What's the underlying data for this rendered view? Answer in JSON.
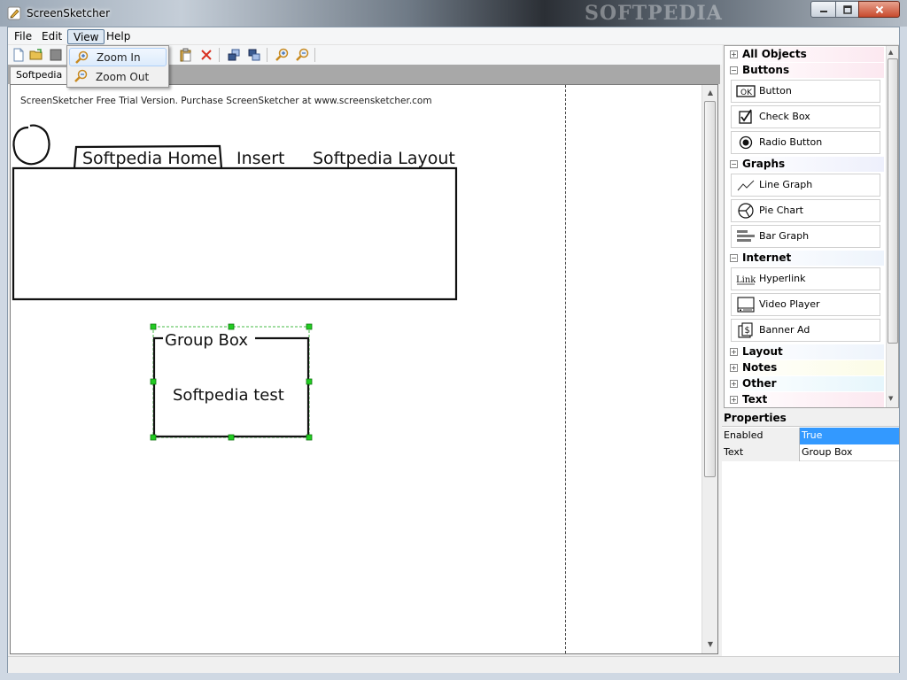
{
  "window": {
    "title": "ScreenSketcher",
    "brand_watermark": "SOFTPEDIA"
  },
  "menu": {
    "items": [
      "File",
      "Edit",
      "View",
      "Help"
    ],
    "active": "View"
  },
  "view_menu": {
    "items": [
      {
        "label": "Zoom In",
        "icon": "zoom-in-icon"
      },
      {
        "label": "Zoom Out",
        "icon": "zoom-out-icon"
      }
    ]
  },
  "document": {
    "tab_label": "Softpedia",
    "trial_text": "ScreenSketcher Free Trial Version. Purchase ScreenSketcher at www.screensketcher.com"
  },
  "sketch": {
    "tabs": [
      "Softpedia Home",
      "Insert",
      "Softpedia Layout"
    ],
    "group_box_title": "Group Box",
    "group_box_text": "Softpedia test"
  },
  "toolbox": {
    "categories": [
      {
        "label": "All Objects",
        "expanded": false
      },
      {
        "label": "Buttons",
        "expanded": true,
        "items": [
          "Button",
          "Check Box",
          "Radio Button"
        ]
      },
      {
        "label": "Graphs",
        "expanded": true,
        "items": [
          "Line Graph",
          "Pie Chart",
          "Bar Graph"
        ]
      },
      {
        "label": "Internet",
        "expanded": true,
        "items": [
          "Hyperlink",
          "Video Player",
          "Banner Ad"
        ]
      },
      {
        "label": "Layout",
        "expanded": false
      },
      {
        "label": "Notes",
        "expanded": false
      },
      {
        "label": "Other",
        "expanded": false
      },
      {
        "label": "Text",
        "expanded": false
      }
    ],
    "button_icon_text": "OK",
    "hyperlink_icon_text": "Link",
    "banner_icon_text": "$"
  },
  "properties": {
    "title": "Properties",
    "rows": [
      {
        "key": "Enabled",
        "value": "True"
      },
      {
        "key": "Text",
        "value": "Group Box"
      }
    ]
  },
  "colors": {
    "selection": "#3399ff",
    "handle": "#22cc22"
  }
}
